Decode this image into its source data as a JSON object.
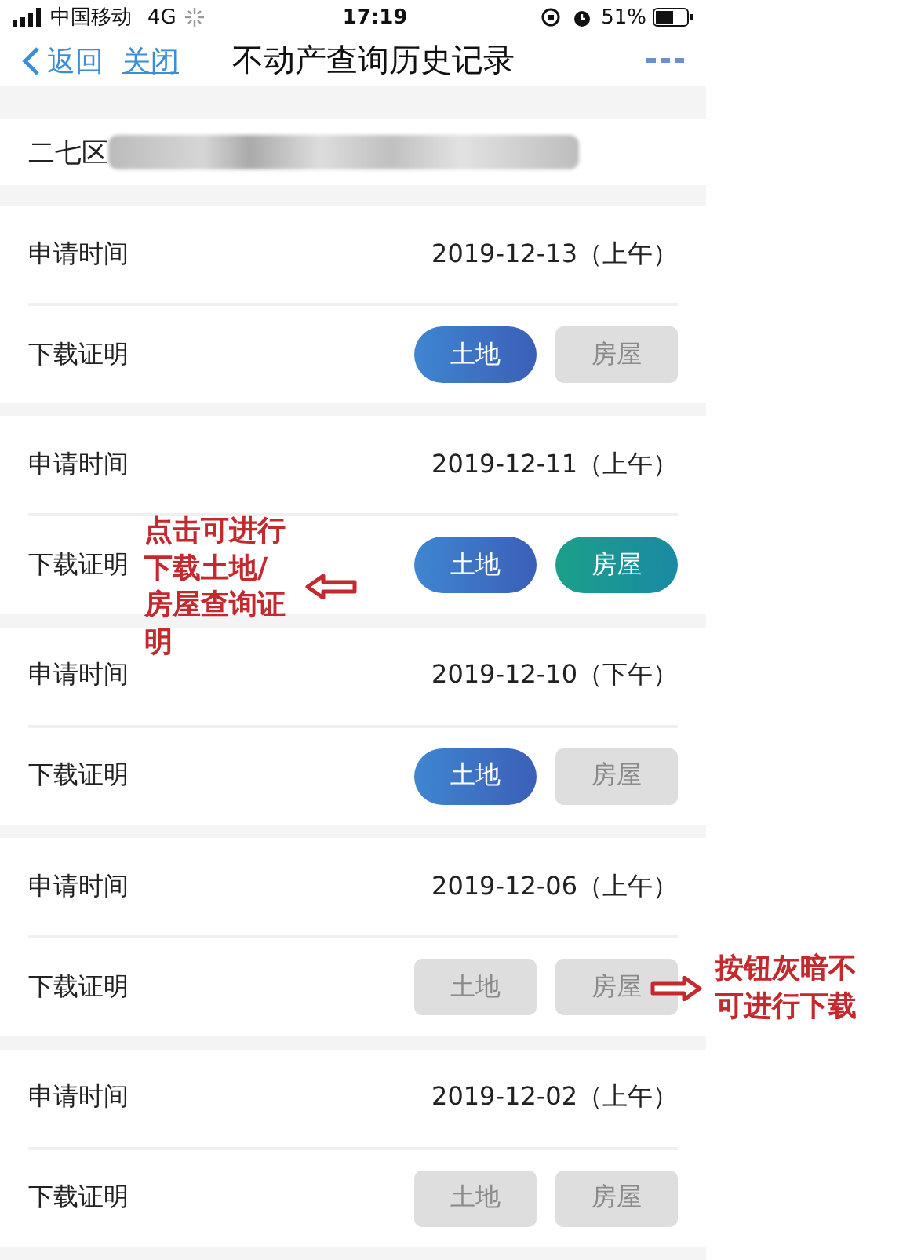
{
  "status_bar": {
    "carrier": "中国移动",
    "network": "4G",
    "time": "17:19",
    "battery": "51%"
  },
  "nav": {
    "back": "返回",
    "close": "关闭",
    "title": "不动产查询历史记录"
  },
  "address": {
    "district": "二七区",
    "redacted": true
  },
  "records": [
    {
      "time_label": "申请时间",
      "time": "2019-12-13（上午）",
      "download_label": "下载证明",
      "buttons": [
        {
          "kind": "land",
          "label": "土地",
          "enabled": true
        },
        {
          "kind": "house",
          "label": "房屋",
          "enabled": false
        }
      ]
    },
    {
      "time_label": "申请时间",
      "time": "2019-12-11（上午）",
      "download_label": "下载证明",
      "buttons": [
        {
          "kind": "land",
          "label": "土地",
          "enabled": true
        },
        {
          "kind": "house",
          "label": "房屋",
          "enabled": true
        }
      ],
      "annotation": {
        "kind": "left",
        "text": "点击可进行下载土地/房屋查询证明"
      }
    },
    {
      "time_label": "申请时间",
      "time": "2019-12-10（下午）",
      "download_label": "下载证明",
      "buttons": [
        {
          "kind": "land",
          "label": "土地",
          "enabled": true
        },
        {
          "kind": "house",
          "label": "房屋",
          "enabled": false
        }
      ]
    },
    {
      "time_label": "申请时间",
      "time": "2019-12-06（上午）",
      "download_label": "下载证明",
      "buttons": [
        {
          "kind": "land",
          "label": "土地",
          "enabled": false
        },
        {
          "kind": "house",
          "label": "房屋",
          "enabled": false
        }
      ],
      "annotation": {
        "kind": "right",
        "text": "按钮灰暗不可进行下载"
      }
    },
    {
      "time_label": "申请时间",
      "time": "2019-12-02（上午）",
      "download_label": "下载证明",
      "buttons": [
        {
          "kind": "land",
          "label": "土地",
          "enabled": false
        },
        {
          "kind": "house",
          "label": "房屋",
          "enabled": false
        }
      ]
    }
  ]
}
